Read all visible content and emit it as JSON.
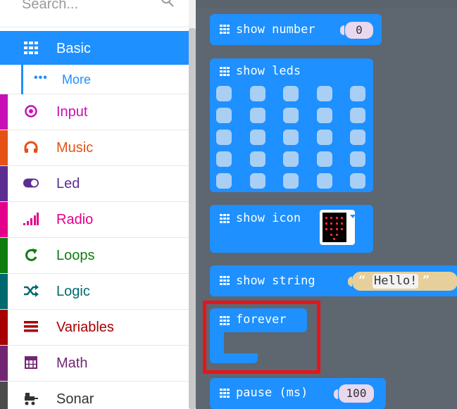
{
  "toolbox": {
    "search_placeholder": "Search...",
    "categories": [
      {
        "label": "Basic",
        "color": "#1e90ff",
        "icon": "grid-icon",
        "selected": true
      },
      {
        "label": "Input",
        "color": "#c90fb3",
        "icon": "target-icon"
      },
      {
        "label": "Music",
        "color": "#e65115",
        "icon": "headphones-icon"
      },
      {
        "label": "Led",
        "color": "#5c2d91",
        "icon": "toggle-icon"
      },
      {
        "label": "Radio",
        "color": "#e3008c",
        "icon": "signal-bars-icon"
      },
      {
        "label": "Loops",
        "color": "#107c10",
        "icon": "loop-arrow-icon"
      },
      {
        "label": "Logic",
        "color": "#006970",
        "icon": "shuffle-icon"
      },
      {
        "label": "Variables",
        "color": "#a80000",
        "icon": "list-lines-icon"
      },
      {
        "label": "Math",
        "color": "#712672",
        "icon": "calculator-icon"
      },
      {
        "label": "Sonar",
        "color": "#4b4b4b",
        "icon": "sonar-icon"
      }
    ],
    "more": {
      "label": "More",
      "icon": "dots-icon"
    }
  },
  "blocks": {
    "show_number": {
      "label": "show number",
      "value": "0"
    },
    "show_leds": {
      "label": "show leds"
    },
    "show_icon": {
      "label": "show icon"
    },
    "show_string": {
      "label": "show string",
      "value": "Hello!",
      "open_quote": "“",
      "close_quote": "”"
    },
    "forever": {
      "label": "forever"
    },
    "pause": {
      "label": "pause (ms)",
      "value": "100"
    }
  },
  "colors": {
    "block": "#1e90ff",
    "workspace": "#5e6670",
    "highlight": "#e8141a"
  }
}
